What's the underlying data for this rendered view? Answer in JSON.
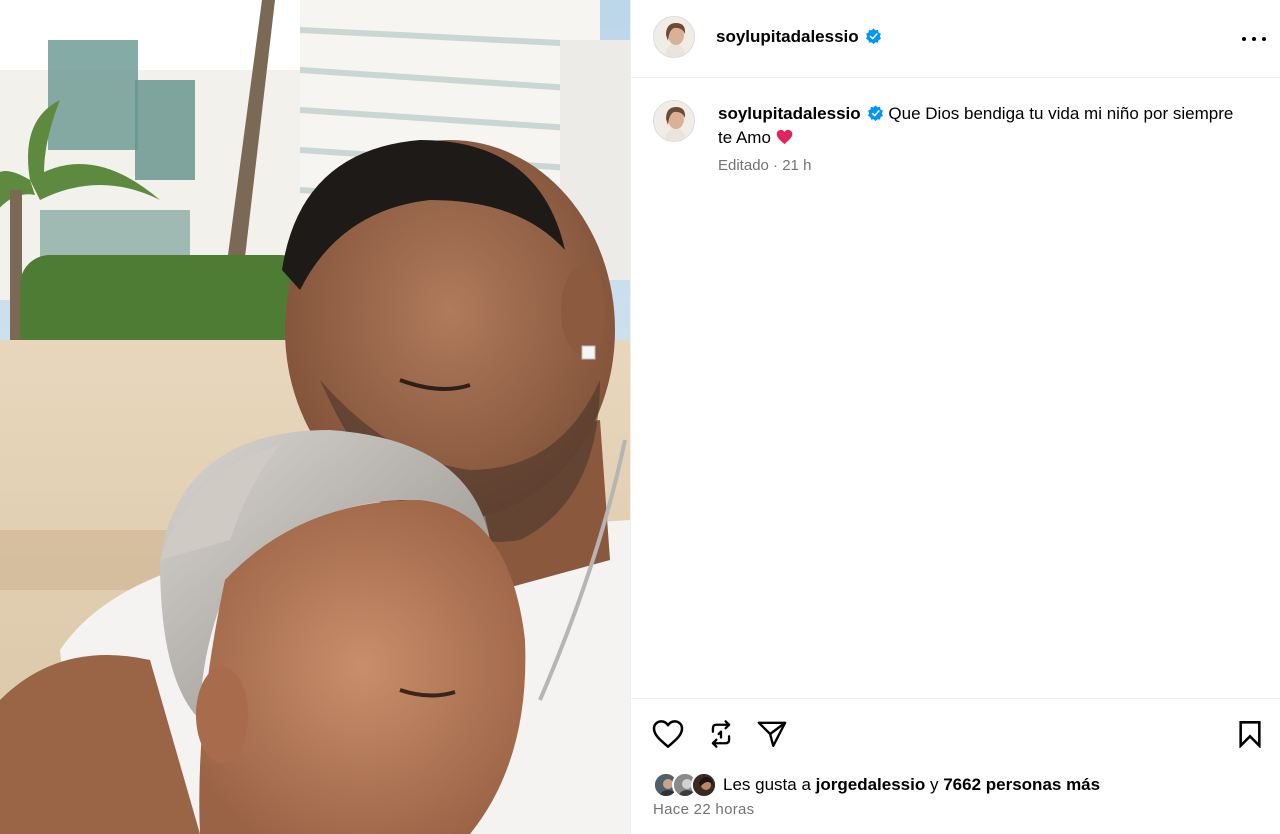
{
  "post": {
    "username": "soylupitadalessio",
    "verified": true,
    "caption_text": "Que Dios bendiga tu vida mi niño por siempre te Amo",
    "caption_emoji": "❤️",
    "edited_label": "Editado",
    "separator": " · ",
    "posted_relative": "21 h",
    "time_ago": "Hace 22 horas"
  },
  "likes": {
    "prefix": "Les gusta a",
    "first_user": "jorgedalessio",
    "conjunction": "y",
    "others": "7662 personas más"
  },
  "icons": {
    "like": "heart-icon",
    "repost": "repost-icon",
    "share": "send-icon",
    "save": "bookmark-icon",
    "more": "more-icon",
    "verified": "verified-badge-icon"
  },
  "colors": {
    "verified_blue": "#0095f6",
    "secondary_text": "#737373",
    "divider": "#efefef",
    "heart_red": "#e0245e"
  }
}
